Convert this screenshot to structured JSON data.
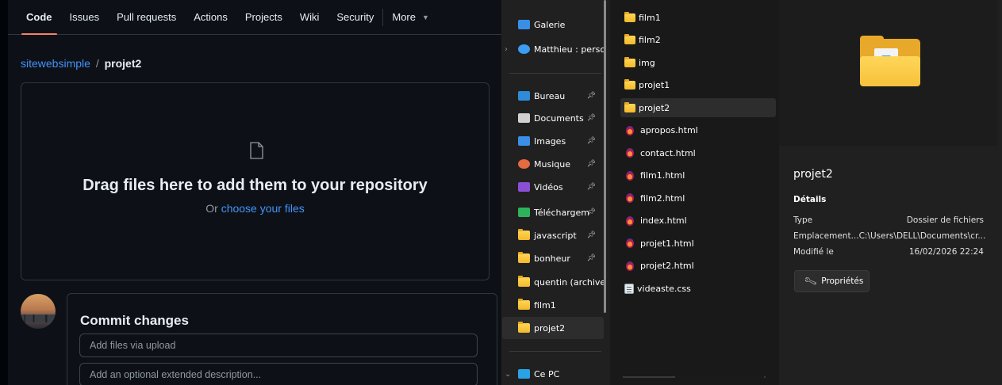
{
  "github": {
    "tabs": [
      "Code",
      "Issues",
      "Pull requests",
      "Actions",
      "Projects",
      "Wiki",
      "Security"
    ],
    "more_label": "More",
    "breadcrumb": {
      "repo": "sitewebsimple",
      "sep": "/",
      "dir": "projet2"
    },
    "dropzone": {
      "title": "Drag files here to add them to your repository",
      "prefix": "Or ",
      "link": "choose your files"
    },
    "commit": {
      "title": "Commit changes",
      "summary_placeholder": "Add files via upload",
      "description_placeholder": "Add an optional extended description..."
    }
  },
  "explorer": {
    "nav": [
      {
        "label": "Galerie",
        "icon": "gallery-icon",
        "color": "#3a8ee6"
      },
      {
        "label": "Matthieu : persc",
        "icon": "onedrive-icon",
        "color": "#3b9cf1"
      },
      {
        "label": "Bureau",
        "icon": "desktop-icon",
        "color": "#2f8bd8",
        "pinned": true
      },
      {
        "label": "Documents",
        "icon": "document-icon",
        "color": "#d0d0d0",
        "pinned": true
      },
      {
        "label": "Images",
        "icon": "images-icon",
        "color": "#3a8ee6",
        "pinned": true
      },
      {
        "label": "Musique",
        "icon": "music-icon",
        "color": "#e46a3f",
        "pinned": true
      },
      {
        "label": "Vidéos",
        "icon": "videos-icon",
        "color": "#8b4fd6",
        "pinned": true
      },
      {
        "label": "Téléchargem",
        "icon": "download-icon",
        "color": "#2fb35a",
        "pinned": true
      },
      {
        "label": "javascript",
        "icon": "folder-icon",
        "pinned": true
      },
      {
        "label": "bonheur",
        "icon": "folder-icon",
        "pinned": true
      },
      {
        "label": "quentin (archive",
        "icon": "folder-icon"
      },
      {
        "label": "film1",
        "icon": "folder-icon"
      },
      {
        "label": "projet2",
        "icon": "folder-icon",
        "selected": true
      },
      {
        "label": "Ce PC",
        "icon": "pc-icon",
        "color": "#2aa3e6"
      }
    ],
    "files": [
      {
        "name": "film1",
        "type": "folder"
      },
      {
        "name": "film2",
        "type": "folder"
      },
      {
        "name": "img",
        "type": "folder"
      },
      {
        "name": "projet1",
        "type": "folder"
      },
      {
        "name": "projet2",
        "type": "folder",
        "selected": true
      },
      {
        "name": "apropos.html",
        "type": "html"
      },
      {
        "name": "contact.html",
        "type": "html"
      },
      {
        "name": "film1.html",
        "type": "html"
      },
      {
        "name": "film2.html",
        "type": "html"
      },
      {
        "name": "index.html",
        "type": "html"
      },
      {
        "name": "projet1.html",
        "type": "html"
      },
      {
        "name": "projet2.html",
        "type": "html"
      },
      {
        "name": "videaste.css",
        "type": "css"
      }
    ],
    "details": {
      "title": "projet2",
      "section": "Détails",
      "rows": [
        {
          "key": "Type",
          "value": "Dossier de fichiers"
        },
        {
          "key": "Emplacement...",
          "value": "C:\\Users\\DELL\\Documents\\cr..."
        },
        {
          "key": "Modifié le",
          "value": "16/02/2026 22:24"
        }
      ],
      "props_button": "Propriétés"
    }
  }
}
